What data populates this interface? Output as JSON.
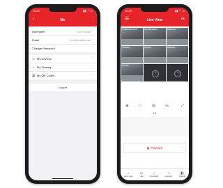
{
  "left_phone": {
    "status": {
      "time": "10:52",
      "signal": "▮▮ ◠ ▭"
    },
    "appbar": {
      "back_icon": "‹",
      "title": "Me"
    },
    "account": [
      {
        "label": "Username",
        "value": "John Sample"
      },
      {
        "label": "Email",
        "value": "John@example.com"
      },
      {
        "label": "Change Password",
        "value": ""
      }
    ],
    "menu": [
      {
        "icon": "▭",
        "label": "My Devices"
      },
      {
        "icon": "⚬",
        "label": "My Sharing"
      },
      {
        "icon": "▦",
        "label": "My QR Codes"
      }
    ],
    "logout_label": "Logout",
    "chevron": "›"
  },
  "right_phone": {
    "status": {
      "time": "10:49",
      "signal": "▮▮ ◠ ▭"
    },
    "appbar": {
      "menu_icon": "☰",
      "title": "Live View",
      "right_icon": "⟳"
    },
    "cameras": [
      {
        "name": "01 Warehouse Area",
        "empty": false
      },
      {
        "name": "02 Loading Dock",
        "empty": false
      },
      {
        "name": "03 Entrance",
        "empty": false
      },
      {
        "name": "04 Parking",
        "empty": false
      },
      {
        "name": "05 Office",
        "empty": false
      },
      {
        "name": "06 Storage",
        "empty": false
      },
      {
        "name": "07 Lobby",
        "empty": false
      },
      {
        "name": "",
        "empty": true
      },
      {
        "name": "",
        "empty": true
      }
    ],
    "controls": [
      {
        "icon": "◉",
        "name": "snapshot-icon"
      },
      {
        "icon": "▭",
        "name": "record-icon"
      },
      {
        "icon": "▤",
        "name": "split-icon"
      },
      {
        "icon": "",
        "name": "fluent",
        "label": "Flu..."
      },
      {
        "icon": "⤢",
        "name": "fullscreen-icon"
      }
    ],
    "page_indicator": "1/1",
    "playback_icon": "▣",
    "playback_label": "Playback",
    "chevron": "›",
    "tabs": [
      {
        "icon": "⌂",
        "label": "Home Cam"
      },
      {
        "icon": "◇",
        "label": "Live"
      },
      {
        "icon": "♪",
        "label": "Live Audio"
      },
      {
        "icon": "☆",
        "label": "Favorites"
      },
      {
        "icon": "◧",
        "label": "Quad M"
      }
    ]
  },
  "colors": {
    "accent": "#e8242b",
    "phone_body": "#1b1b1d",
    "screen_bg": "#f2f2f4"
  }
}
